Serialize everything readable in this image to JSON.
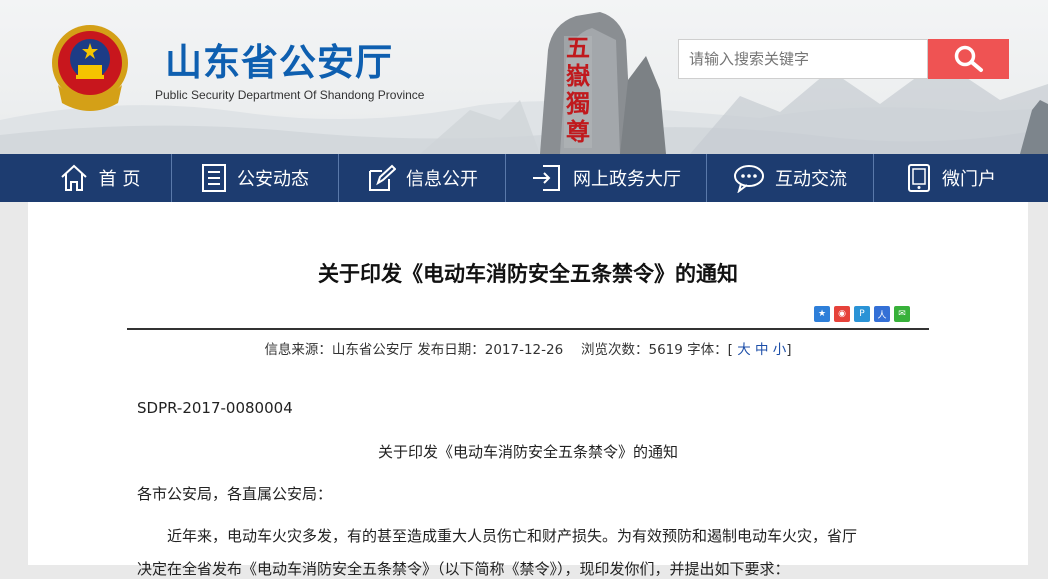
{
  "header": {
    "title": "山东省公安厅",
    "subtitle": "Public Security Department Of Shandong Province",
    "search_placeholder": "请输入搜索关键字",
    "rock_text": "五嶽獨尊"
  },
  "nav": {
    "items": [
      {
        "label": "首 页",
        "icon": "home-icon"
      },
      {
        "label": "公安动态",
        "icon": "document-list-icon"
      },
      {
        "label": "信息公开",
        "icon": "edit-icon"
      },
      {
        "label": "网上政务大厅",
        "icon": "login-icon"
      },
      {
        "label": "互动交流",
        "icon": "chat-icon"
      },
      {
        "label": "微门户",
        "icon": "tablet-icon"
      }
    ]
  },
  "article": {
    "title": "关于印发《电动车消防安全五条禁令》的通知",
    "meta_prefix": "信息来源：山东省公安厅 发布日期：2017-12-26　 浏览次数：5619 字体：[",
    "size_large": "大",
    "size_medium": "中",
    "size_small": "小",
    "meta_suffix": "]",
    "doc_number": "SDPR-2017-0080004",
    "inner_title": "关于印发《电动车消防安全五条禁令》的通知",
    "salutation": "各市公安局，各直属公安局：",
    "para1_line1": "近年来，电动车火灾多发，有的甚至造成重大人员伤亡和财产损失。为有效预防和遏制电动车火灾，省厅",
    "para1_line2": "决定在全省发布《电动车消防安全五条禁令》（以下简称《禁令》），现印发你们，并提出如下要求："
  },
  "colors": {
    "nav_bg": "#1d3c70",
    "title_blue": "#0e5fb0",
    "search_red": "#ef5353"
  }
}
